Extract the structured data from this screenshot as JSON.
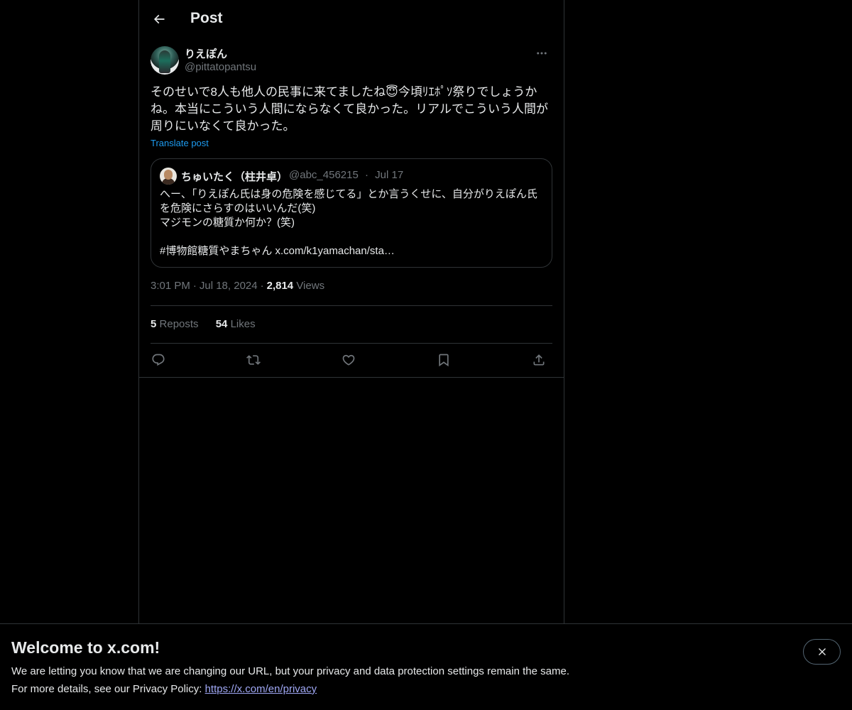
{
  "header": {
    "title": "Post"
  },
  "author": {
    "display_name": "りえぽん",
    "handle": "@pittatopantsu"
  },
  "post": {
    "text": "そのせいで8人も他人の民事に来てましたね😇今頃ﾘｴﾎﾟｿ祭りでしょうか\nね。本当にこういう人間にならなくて良かった。リアルでこういう人間が\n周りにいなくて良かった。",
    "translate_label": "Translate post",
    "time": "3:01 PM",
    "date": "Jul 18, 2024",
    "separator": "·",
    "views_count": "2,814",
    "views_label": "Views"
  },
  "quote": {
    "display_name": "ちゅいたく（柱井卓）",
    "handle": "@abc_456215",
    "date": "Jul 17",
    "separator": "·",
    "text": "へー、「りえぽん氏は身の危険を感じてる」とか言うくせに、自分がりえぽん氏\nを危険にさらすのはいいんだ(笑)\nマジモンの糖質か何か？(笑)\n\n#博物館糖質やまちゃん x.com/k1yamachan/sta…"
  },
  "stats": {
    "reposts_count": "5",
    "reposts_label": "Reposts",
    "likes_count": "54",
    "likes_label": "Likes"
  },
  "actions": [
    "reply-icon",
    "repost-icon",
    "like-icon",
    "bookmark-icon",
    "share-icon"
  ],
  "banner": {
    "title": "Welcome to x.com!",
    "line1": "We are letting you know that we are changing our URL, but your privacy and data protection settings remain the same.",
    "line2_prefix": "For more details, see our Privacy Policy: ",
    "link": "https://x.com/en/privacy"
  },
  "colors": {
    "background": "#000000",
    "text": "#e7e9ea",
    "muted": "#71767b",
    "accent": "#1d9bf0",
    "border": "#2f3336"
  }
}
